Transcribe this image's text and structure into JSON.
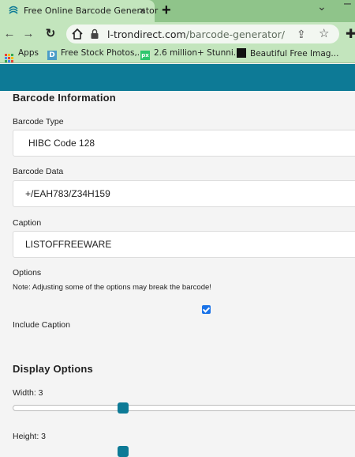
{
  "browser": {
    "tab_title": "Free Online Barcode Generator",
    "tab_close": "×",
    "new_tab": "+",
    "url_host": "l-trondirect.com",
    "url_path": "/barcode-generator/",
    "bookmarks": [
      {
        "label": "Apps",
        "icon": "apps-grid-icon"
      },
      {
        "label": "Free Stock Photos,...",
        "icon": "bookmark-favicon-d"
      },
      {
        "label": "2.6 million+ Stunni...",
        "icon": "pixabay-favicon"
      },
      {
        "label": "Beautiful Free Imag...",
        "icon": "unsplash-favicon"
      }
    ]
  },
  "page": {
    "barcode_info_title": "Barcode Information",
    "barcode_type_label": "Barcode Type",
    "barcode_type_value": "HIBC Code 128",
    "barcode_data_label": "Barcode Data",
    "barcode_data_value": "+/EAH783/Z34H159",
    "caption_label": "Caption",
    "caption_value": "LISTOFFREEWARE",
    "options_label": "Options",
    "options_note": "Note: Adjusting some of the options may break the barcode!",
    "include_caption_label": "Include Caption",
    "include_caption_checked": true,
    "display_options_title": "Display Options",
    "width_label": "Width: 3",
    "width_value": 3,
    "height_label": "Height: 3",
    "height_value": 3
  },
  "colors": {
    "header": "#0d7a96",
    "tab_bar": "#8fc48a",
    "toolbar": "#c3e5bd",
    "checkbox": "#1a73e8"
  }
}
